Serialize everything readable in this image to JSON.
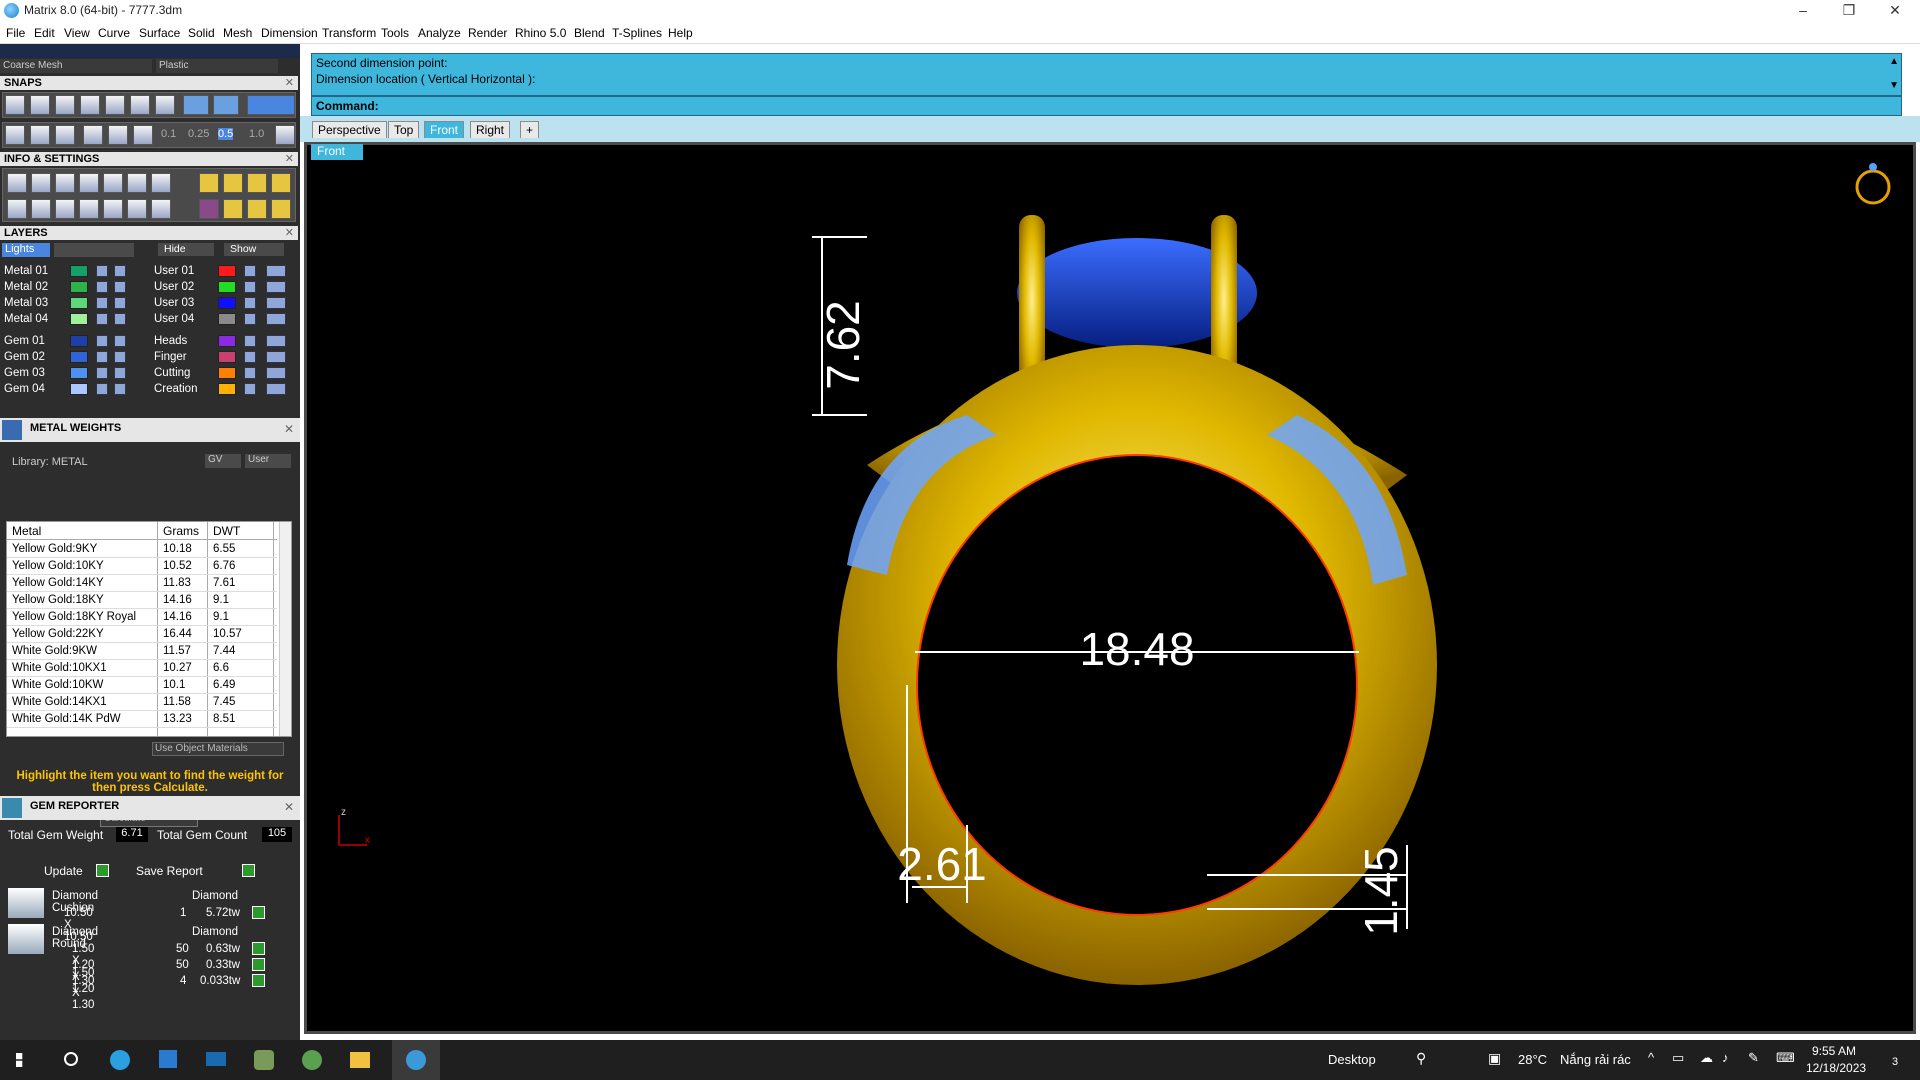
{
  "window": {
    "title": "Matrix 8.0 (64-bit) - 7777.3dm",
    "controls": [
      "–",
      "❐",
      "✕"
    ]
  },
  "menu": [
    "File",
    "Edit",
    "View",
    "Curve",
    "Surface",
    "Solid",
    "Mesh",
    "Dimension",
    "Transform",
    "Tools",
    "Analyze",
    "Render",
    "Rhino 5.0",
    "Blend",
    "T-Splines",
    "Help"
  ],
  "toolbar_top": {
    "mesh_mode": "Coarse Mesh",
    "material": "Plastic"
  },
  "snaps": {
    "title": "SNAPS",
    "values": [
      "0.1",
      "0.25",
      "0.5",
      "1.0"
    ]
  },
  "info_settings": {
    "title": "INFO & SETTINGS"
  },
  "layers": {
    "title": "LAYERS",
    "lights": "Lights",
    "hide": "Hide",
    "show": "Show",
    "left": [
      {
        "name": "Metal 01",
        "color": "#14a06a"
      },
      {
        "name": "Metal 02",
        "color": "#2db34a"
      },
      {
        "name": "Metal 03",
        "color": "#5ed67a"
      },
      {
        "name": "Metal 04",
        "color": "#9ff09a"
      },
      {
        "name": "Gem 01",
        "color": "#1e3fa8"
      },
      {
        "name": "Gem 02",
        "color": "#2f63d6"
      },
      {
        "name": "Gem 03",
        "color": "#4f8ff0"
      },
      {
        "name": "Gem 04",
        "color": "#a9c8ff"
      }
    ],
    "right": [
      {
        "name": "User 01",
        "color": "#ff1a1a"
      },
      {
        "name": "User 02",
        "color": "#22dd22"
      },
      {
        "name": "User 03",
        "color": "#1010ff"
      },
      {
        "name": "User 04",
        "color": "#8a8a8a"
      },
      {
        "name": "Heads",
        "color": "#8a2be2"
      },
      {
        "name": "Finger",
        "color": "#c84070"
      },
      {
        "name": "Cutting",
        "color": "#ff7f00"
      },
      {
        "name": "Creation",
        "color": "#ffb000"
      }
    ]
  },
  "metal_weights": {
    "title": "METAL WEIGHTS",
    "library": "Library: METAL",
    "gv": "GV",
    "user": "User",
    "columns": [
      "Metal",
      "Grams",
      "DWT"
    ],
    "rows": [
      [
        "Yellow Gold:9KY",
        "10.18",
        "6.55"
      ],
      [
        "Yellow Gold:10KY",
        "10.52",
        "6.76"
      ],
      [
        "Yellow Gold:14KY",
        "11.83",
        "7.61"
      ],
      [
        "Yellow Gold:18KY",
        "14.16",
        "9.1"
      ],
      [
        "Yellow Gold:18KY Royal",
        "14.16",
        "9.1"
      ],
      [
        "Yellow Gold:22KY",
        "16.44",
        "10.57"
      ],
      [
        "White Gold:9KW",
        "11.57",
        "7.44"
      ],
      [
        "White Gold:10KX1",
        "10.27",
        "6.6"
      ],
      [
        "White Gold:10KW",
        "10.1",
        "6.49"
      ],
      [
        "White Gold:14KX1",
        "11.58",
        "7.45"
      ],
      [
        "White Gold:14K PdW",
        "13.23",
        "8.51"
      ]
    ],
    "use_object_materials": "Use Object Materials",
    "hint": "Highlight the item you want to find the weight for then press Calculate.",
    "calculate": "Calculate"
  },
  "gem_reporter": {
    "title": "GEM REPORTER",
    "total_weight_label": "Total Gem Weight",
    "total_weight": "6.71",
    "total_count_label": "Total Gem Count",
    "total_count": "105",
    "update": "Update",
    "save_report": "Save Report",
    "groups": [
      {
        "shape": "Diamond Cushion",
        "material": "Diamond",
        "rows": [
          {
            "size": "10.50 X 10.50",
            "qty": "1",
            "weight": "5.72tw"
          }
        ]
      },
      {
        "shape": "Diamond Round",
        "material": "Diamond",
        "rows": [
          {
            "size": "1.50 X 1.50",
            "qty": "50",
            "weight": "0.63tw"
          },
          {
            "size": "1.20 X 1.20",
            "qty": "50",
            "weight": "0.33tw"
          },
          {
            "size": "1.30 X 1.30",
            "qty": "4",
            "weight": "0.033tw"
          }
        ]
      }
    ]
  },
  "command": {
    "history": [
      "Second dimension point:",
      "Dimension location ( Vertical  Horizontal ):"
    ],
    "prompt": "Command:"
  },
  "viewport_tabs": [
    "Perspective",
    "Top",
    "Front",
    "Right",
    "+"
  ],
  "active_view": "Front",
  "dimensions": {
    "inner_diameter": "18.48",
    "head_height": "7.62",
    "shank_width": "2.61",
    "shank_thickness": "1.45"
  },
  "axis": {
    "z": "z",
    "x": "x"
  },
  "taskbar": {
    "desktop": "Desktop",
    "weather_temp": "28°C",
    "weather_text": "Nắng rải rác",
    "time": "9:55 AM",
    "date": "12/18/2023",
    "notifications": "3"
  }
}
